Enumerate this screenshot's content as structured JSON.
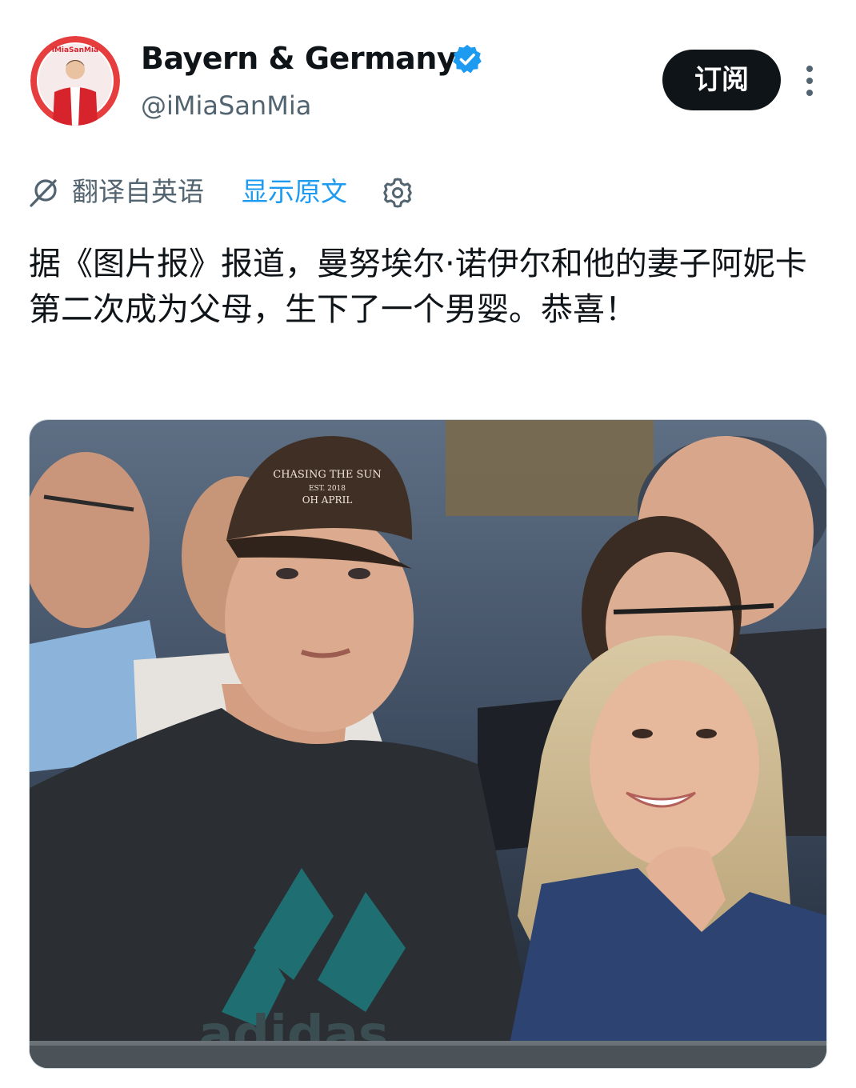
{
  "account": {
    "display_name": "Bayern & Germany",
    "handle": "@iMiaSanMia",
    "verified": true,
    "avatar_badge_text": "iMiaSanMia"
  },
  "actions": {
    "subscribe_label": "订阅",
    "more_icon": "more-vertical-icon"
  },
  "translation": {
    "label": "翻译自英语",
    "show_original": "显示原文",
    "icon": "translate-icon",
    "settings_icon": "gear-icon"
  },
  "tweet": {
    "text": "据《图片报》报道，曼努埃尔·诺伊尔和他的妻子阿妮卡第二次成为父母，生下了一个男婴。恭喜！"
  },
  "media": {
    "description_icon": "photo",
    "cap_text_line1": "CHASING THE SUN",
    "cap_text_line2": "EST. 2018",
    "cap_text_line3": "OH APRIL",
    "shirt_logo": "adidas"
  },
  "colors": {
    "text_primary": "#0f1419",
    "text_secondary": "#536471",
    "link": "#1d9bf0",
    "verified": "#1d9bf0",
    "button_bg": "#0f1419"
  }
}
